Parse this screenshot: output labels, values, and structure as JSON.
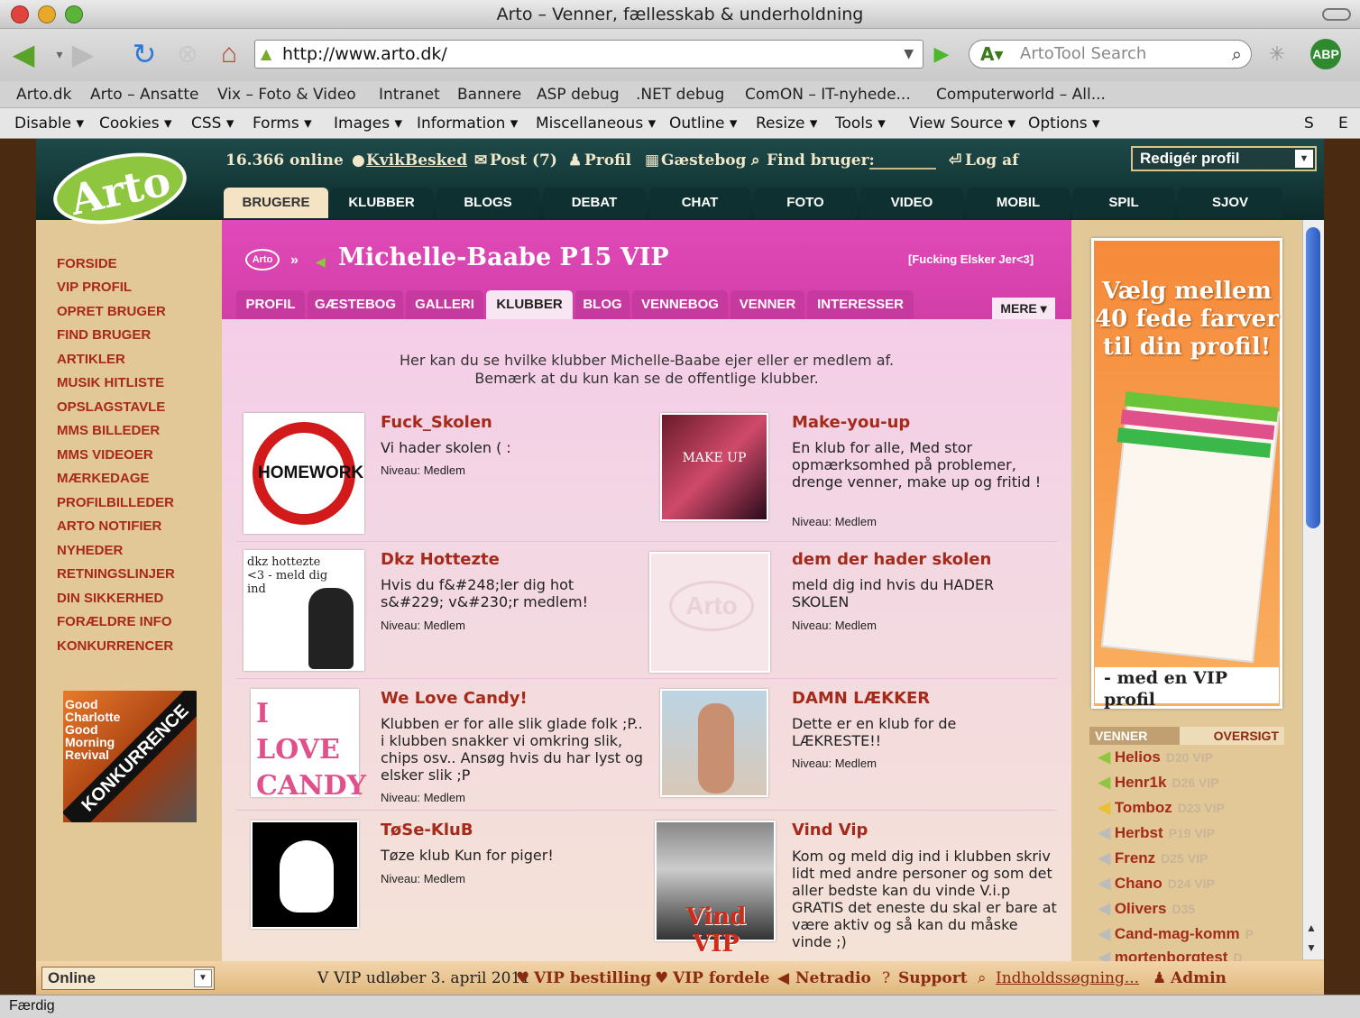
{
  "window": {
    "title": "Arto – Venner, fællesskab & underholdning"
  },
  "nav": {
    "url": "http://www.arto.dk/",
    "search_placeholder": "ArtoTool Search",
    "abp_label": "ABP"
  },
  "bookmarks": [
    "Arto.dk",
    "Arto – Ansatte",
    "Vix – Foto & Video",
    "Intranet",
    "Bannere",
    "ASP debug",
    ".NET debug",
    "ComON – IT-nyhede...",
    "Computerworld – All..."
  ],
  "devbar": [
    "Disable ▾",
    "Cookies ▾",
    "CSS ▾",
    "Forms ▾",
    "Images ▾",
    "Information ▾",
    "Miscellaneous ▾",
    "Outline ▾",
    "Resize ▾",
    "Tools ▾",
    "View Source ▾",
    "Options ▾",
    "S",
    "E"
  ],
  "header": {
    "logo": "Arto",
    "online": "16.366 online",
    "links": [
      "KvikBesked",
      "Post (7)",
      "Profil",
      "Gæstebog",
      "Find bruger:",
      "Log af"
    ],
    "profile_dropdown": "Redigér profil"
  },
  "tabs": [
    "BRUGERE",
    "KLUBBER",
    "BLOGS",
    "DEBAT",
    "CHAT",
    "FOTO",
    "VIDEO",
    "MOBIL",
    "SPIL",
    "SJOV"
  ],
  "sidebar": [
    "FORSIDE",
    "VIP PROFIL",
    "OPRET BRUGER",
    "FIND BRUGER",
    "ARTIKLER",
    "MUSIK HITLISTE",
    "OPSLAGSTAVLE",
    "MMS BILLEDER",
    "MMS VIDEOER",
    "MÆRKEDAGE",
    "PROFILBILLEDER",
    "ARTO NOTIFIER",
    "NYHEDER",
    "RETNINGSLINJER",
    "DIN SIKKERHED",
    "FORÆLDRE INFO",
    "KONKURRENCER"
  ],
  "promo": {
    "small_text": "Good Charlotte Good Morning Revival",
    "banner": "KONKURRENCE"
  },
  "profile": {
    "logo": "Arto",
    "name": "Michelle-Baabe P15 VIP",
    "subtitle": "[Fucking Elsker Jer<3]",
    "subtabs": [
      "PROFIL",
      "GÆSTEBOG",
      "GALLERI",
      "KLUBBER",
      "BLOG",
      "VENNEBOG",
      "VENNER",
      "INTERESSER"
    ],
    "more": "MERE",
    "intro_line1": "Her kan du se hvilke klubber Michelle-Baabe ejer eller er medlem af.",
    "intro_line2": "Bemærk at du kun kan se de offentlige klubber."
  },
  "clubs": [
    {
      "title": "Fuck_Skolen",
      "desc": "Vi hader skolen ( :",
      "level": "Niveau: Medlem",
      "img": "HOMEWORK"
    },
    {
      "title": "Make-you-up",
      "desc": "En klub for alle, Med stor opmærksomhed på problemer, drenge venner, make up og fritid !",
      "level": "Niveau: Medlem",
      "img": "MAKE UP"
    },
    {
      "title": "Dkz Hottezte",
      "desc": "Hvis du f&#248;ler dig hot s&#229; v&#230;r medlem!",
      "level": "Niveau: Medlem",
      "img": "dkz hottezte <3 - meld dig ind"
    },
    {
      "title": "dem der hader skolen",
      "desc": "meld dig ind hvis du HADER SKOLEN",
      "level": "Niveau: Medlem",
      "img": "Arto"
    },
    {
      "title": "We Love Candy!",
      "desc": "Klubben er for alle slik glade folk ;P.. i klubben snakker vi omkring slik, chips osv.. Ansøg hvis du har lyst og elsker slik ;P",
      "level": "Niveau: Medlem",
      "img": "I LOVE CANDY"
    },
    {
      "title": "DAMN LÆKKER",
      "desc": "Dette er en klub for de LÆKRESTE!!",
      "level": "Niveau: Medlem",
      "img": ""
    },
    {
      "title": "TøSe-KluB",
      "desc": "Tøze klub Kun for piger!",
      "level": "Niveau: Medlem",
      "img": ""
    },
    {
      "title": "Vind Vip",
      "desc": "Kom og meld dig ind i klubben skriv lidt med andre personer og som det aller bedste kan du vinde V.i.p GRATIS det eneste du skal er bare at være aktiv og så kan du måske vinde ;)",
      "level": "Niveau: Medlem",
      "img": "Vind VIP"
    }
  ],
  "ad": {
    "title": "Vælg mellem 40 fede farver til din profil!",
    "footer": "- med en VIP profil"
  },
  "friends": {
    "header_left": "VENNER",
    "header_right": "OVERSIGT",
    "list": [
      {
        "name": "Helios",
        "meta": "D20 VIP"
      },
      {
        "name": "Henr1k",
        "meta": "D26 VIP"
      },
      {
        "name": "Tomboz",
        "meta": "D23 VIP"
      },
      {
        "name": "Herbst",
        "meta": "P19 VIP"
      },
      {
        "name": "Frenz",
        "meta": "D25 VIP"
      },
      {
        "name": "Chano",
        "meta": "D24 VIP"
      },
      {
        "name": "Olivers",
        "meta": "D35"
      },
      {
        "name": "Cand-mag-komm",
        "meta": "P"
      },
      {
        "name": "mortenborgtest",
        "meta": "D"
      }
    ]
  },
  "footer": {
    "status": "Online",
    "vip_expiry": "VIP udløber 3. april 2011",
    "links": [
      "VIP bestilling",
      "VIP fordele",
      "Netradio",
      "Support",
      "Indholdssøgning...",
      "Admin"
    ]
  },
  "statusbar": "Færdig",
  "colors": {
    "accent": "#a42a1a",
    "pink": "#d23ea8",
    "teal": "#0e3030",
    "green": "#8ec63f"
  }
}
